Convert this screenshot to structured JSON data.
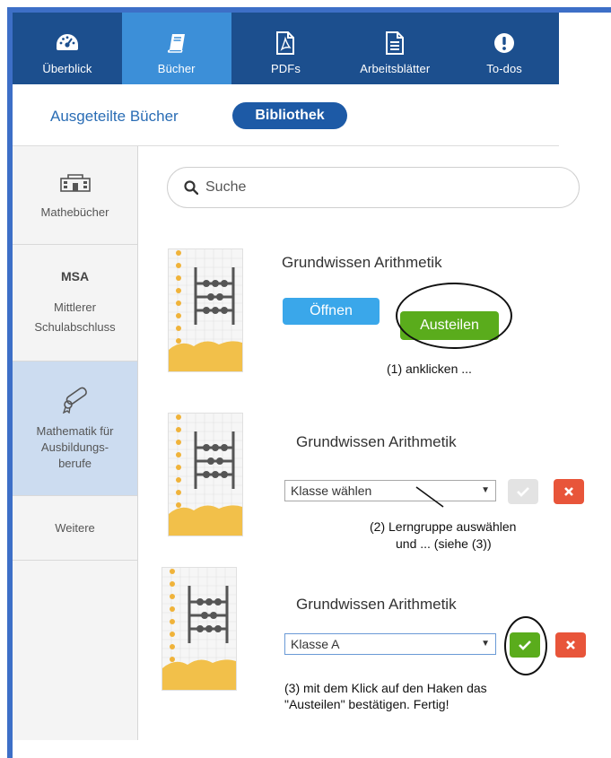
{
  "nav": {
    "items": [
      {
        "label": "Überblick",
        "icon": "dashboard-icon"
      },
      {
        "label": "Bücher",
        "icon": "book-icon"
      },
      {
        "label": "PDFs",
        "icon": "pdf-icon"
      },
      {
        "label": "Arbeitsblätter",
        "icon": "worksheet-icon"
      },
      {
        "label": "To-dos",
        "icon": "alert-icon"
      }
    ],
    "active": "Bücher"
  },
  "subnav": {
    "link": "Ausgeteilte Bücher",
    "pill": "Bibliothek"
  },
  "sidebar": {
    "items": [
      {
        "label": "Mathebücher",
        "icon": "school-building-icon"
      },
      {
        "abbr": "MSA",
        "label_line1": "Mittlerer",
        "label_line2": "Schulabschluss"
      },
      {
        "label_line1": "Mathematik für",
        "label_line2": "Ausbildungs-",
        "label_line3": "berufe",
        "icon": "diploma-icon"
      },
      {
        "label": "Weitere"
      }
    ]
  },
  "search": {
    "placeholder": "Suche"
  },
  "books": [
    {
      "title": "Grundwissen Arithmetik",
      "open_label": "Öffnen",
      "assign_label": "Austeilen",
      "note": "(1) anklicken ..."
    },
    {
      "title": "Grundwissen Arithmetik",
      "select_value": "Klasse wählen",
      "note_line1": "(2) Lerngruppe auswählen",
      "note_line2": "und ... (siehe (3))"
    },
    {
      "title": "Grundwissen Arithmetik",
      "select_value": "Klasse A",
      "note_line1": "(3) mit dem Klick auf den Haken das",
      "note_line2": "\"Austeilen\" bestätigen. Fertig!"
    }
  ],
  "colors": {
    "nav_bg": "#1c4f8e",
    "nav_active": "#3c8fd8",
    "open_button": "#3aa7ea",
    "assign_button": "#5aac1c",
    "cancel_button": "#e8553a"
  }
}
